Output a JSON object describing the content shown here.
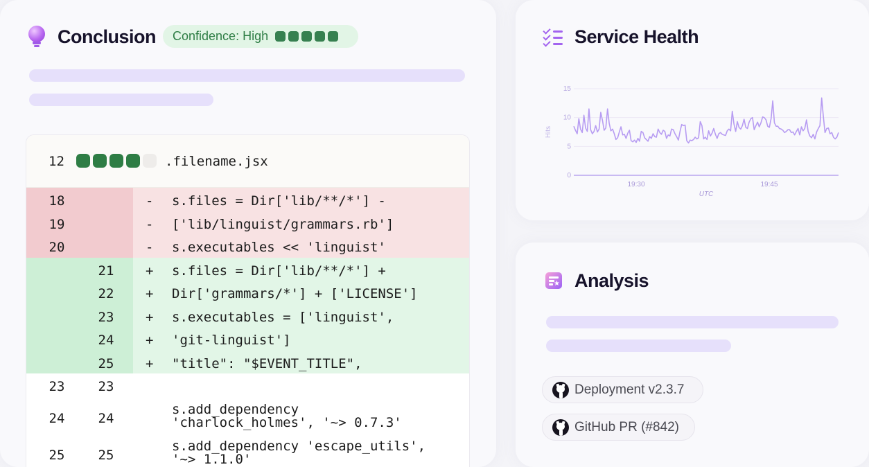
{
  "conclusion": {
    "title": "Conclusion",
    "confidence_label": "Confidence: High",
    "confidence_level": 5,
    "confidence_max": 5
  },
  "diff": {
    "count": "12",
    "score": 4,
    "score_max": 5,
    "filename": ".filename.jsx",
    "rows": [
      {
        "type": "del",
        "old": "18",
        "new": "",
        "sign": "-",
        "code": "s.files = Dir['lib/**/*'] -"
      },
      {
        "type": "del",
        "old": "19",
        "new": "",
        "sign": "-",
        "code": "['lib/linguist/grammars.rb']"
      },
      {
        "type": "del",
        "old": "20",
        "new": "",
        "sign": "-",
        "code": "s.executables << 'linguist'"
      },
      {
        "type": "add",
        "old": "",
        "new": "21",
        "sign": "+",
        "code": "s.files = Dir['lib/**/*'] +"
      },
      {
        "type": "add",
        "old": "",
        "new": "22",
        "sign": "+",
        "code": "Dir['grammars/*'] + ['LICENSE']"
      },
      {
        "type": "add",
        "old": "",
        "new": "23",
        "sign": "+",
        "code": "s.executables = ['linguist',"
      },
      {
        "type": "add",
        "old": "",
        "new": "24",
        "sign": "+",
        "code": "'git-linguist']"
      },
      {
        "type": "add",
        "old": "",
        "new": "25",
        "sign": "+",
        "code": "\"title\": \"$EVENT_TITLE\","
      },
      {
        "type": "ctx",
        "old": "23",
        "new": "23",
        "sign": "",
        "code": ""
      },
      {
        "type": "ctx",
        "old": "24",
        "new": "24",
        "sign": "",
        "code": "s.add_dependency\n'charlock_holmes', '~> 0.7.3'"
      },
      {
        "type": "ctx",
        "old": "25",
        "new": "25",
        "sign": "",
        "code": "s.add_dependency 'escape_utils',\n'~> 1.1.0'"
      }
    ]
  },
  "service_health": {
    "title": "Service Health"
  },
  "chart_data": {
    "type": "line",
    "title": "",
    "xlabel": "UTC",
    "ylabel": "Hits",
    "x_ticks": [
      "19:30",
      "19:45"
    ],
    "y_ticks": [
      "0",
      "5",
      "10",
      "15"
    ],
    "ylim": [
      0,
      15
    ],
    "grid": true,
    "color": "#b79cf2",
    "series": [
      {
        "values": [
          8.5,
          7.8,
          7.2,
          9.8,
          8.0,
          7.4,
          10.4,
          8.2,
          7.6,
          11.5,
          7.9,
          7.2,
          7.6,
          8.6,
          7.5,
          8.0,
          10.9,
          9.5,
          7.8,
          8.2,
          11.5,
          9.0,
          7.7,
          8.0,
          7.2,
          6.2,
          6.5,
          7.5,
          8.4,
          7.0,
          7.1,
          6.4,
          7.3,
          7.8,
          6.0,
          5.8,
          6.1,
          5.7,
          6.4,
          5.9,
          7.6,
          7.4,
          6.5,
          6.2,
          5.9,
          6.7,
          6.4,
          7.2,
          6.7,
          6.6,
          8.0,
          7.4,
          7.1,
          7.8,
          7.6,
          6.4,
          7.0,
          6.8,
          8.0,
          7.9,
          7.2,
          6.7,
          6.1,
          7.6,
          8.8,
          8.6,
          8.7,
          6.0,
          5.6,
          6.1,
          6.0,
          6.2,
          6.6,
          6.3,
          6.5,
          9.3,
          8.6,
          6.3,
          6.6,
          6.2,
          7.7,
          6.8,
          7.3,
          8.1,
          7.1,
          6.4,
          7.2,
          7.4,
          7.1,
          7.0,
          6.9,
          7.7,
          8.0,
          7.7,
          11.1,
          8.9,
          7.6,
          9.3,
          8.3,
          8.0,
          8.6,
          9.7,
          8.3,
          8.1,
          9.2,
          9.8,
          10.0,
          7.9,
          8.6,
          9.2,
          8.4,
          9.1,
          10.1,
          10.0,
          9.6,
          8.5,
          8.3,
          9.8,
          12.9,
          9.1,
          8.5,
          8.5,
          8.1,
          8.0,
          7.8,
          7.4,
          7.6,
          7.9,
          7.9,
          7.4,
          7.5,
          7.0,
          7.6,
          8.1,
          7.0,
          8.4,
          7.7,
          8.1,
          9.6,
          7.6,
          6.8,
          6.5,
          7.1,
          6.3,
          7.5,
          8.1,
          8.6,
          13.4,
          10.2,
          7.4,
          8.1,
          8.2,
          7.2,
          7.4,
          6.6,
          6.3,
          6.6,
          7.4
        ]
      }
    ]
  },
  "analysis": {
    "title": "Analysis",
    "chips": [
      {
        "label": "Deployment v2.3.7"
      },
      {
        "label": "GitHub PR (#842)"
      }
    ]
  }
}
